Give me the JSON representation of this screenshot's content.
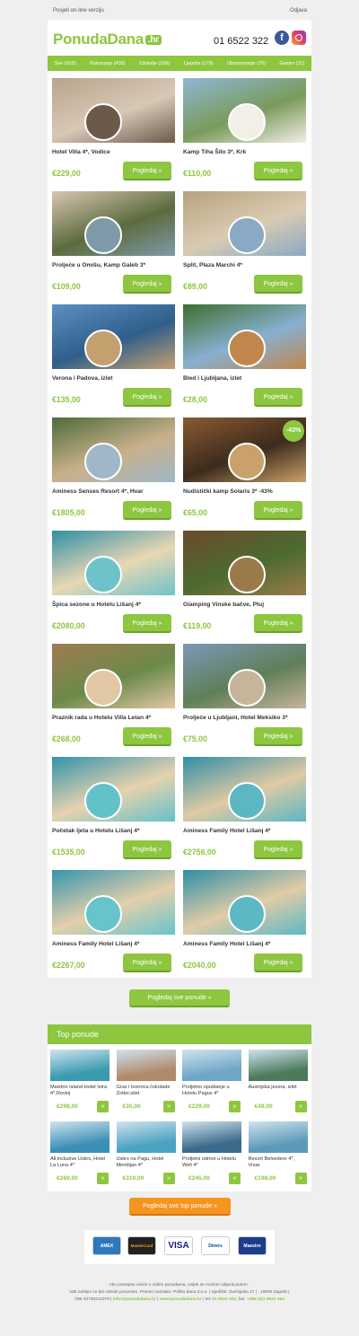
{
  "topbar": {
    "online_label": "Posjeti on-line verziju",
    "unsubscribe_label": "Odjava"
  },
  "header": {
    "logo_text": "PonudaDana",
    "logo_suffix": ".hr",
    "phone": "01 6522 322"
  },
  "nav": [
    {
      "label": "Sve (910)"
    },
    {
      "label": "Putovanja (439)"
    },
    {
      "label": "Zdravlje (166)"
    },
    {
      "label": "Ljepota (179)"
    },
    {
      "label": "Obrazovanje (70)"
    },
    {
      "label": "Gastro (11)"
    }
  ],
  "offers": [
    {
      "title": "Hotel Villa 4*, Vodice",
      "price": "€229,00",
      "button": "Pogledaj »"
    },
    {
      "title": "Kamp Tiha Šilo 3*, Krk",
      "price": "€110,00",
      "button": "Pogledaj »"
    },
    {
      "title": "Proljeće u Omišu, Kamp Galeb 3*",
      "price": "€109,00",
      "button": "Pogledaj »"
    },
    {
      "title": "Split, Plaza Marchi 4*",
      "price": "€89,00",
      "button": "Pogledaj »"
    },
    {
      "title": "Verona i Padova, izlet",
      "price": "€135,00",
      "button": "Pogledaj »"
    },
    {
      "title": "Bled i Ljubljana, izlet",
      "price": "€28,00",
      "button": "Pogledaj »"
    },
    {
      "title": "Aminess Senses Resort 4*, Hvar",
      "price": "€1805,00",
      "button": "Pogledaj »"
    },
    {
      "title": "Nudistički kamp Solaris 3* -43%",
      "price": "€65,00",
      "button": "Pogledaj »",
      "badge": "-43%"
    },
    {
      "title": "Špica sezone u Hotelu Lišanj 4*",
      "price": "€2080,00",
      "button": "Pogledaj »"
    },
    {
      "title": "Glamping Vinske bačve, Ptuj",
      "price": "€119,00",
      "button": "Pogledaj »"
    },
    {
      "title": "Praznik rada u Hotelu Villa Letan 4*",
      "price": "€268,00",
      "button": "Pogledaj »"
    },
    {
      "title": "Proljeće u Ljubljani, Hotel Meksiko 3*",
      "price": "€75,00",
      "button": "Pogledaj »"
    },
    {
      "title": "Početak ljeta u Hotelu Lišanj 4*",
      "price": "€1535,00",
      "button": "Pogledaj »"
    },
    {
      "title": "Aminess Family Hotel Lišanj 4*",
      "price": "€2756,00",
      "button": "Pogledaj »"
    },
    {
      "title": "Aminess Family Hotel Lišanj 4*",
      "price": "€2267,00",
      "button": "Pogledaj »"
    },
    {
      "title": "Aminess Family Hotel Lišanj 4*",
      "price": "€2040,00",
      "button": "Pogledaj »"
    }
  ],
  "see_all_label": "Pogledaj sve ponude »",
  "top_offers": {
    "heading": "Top ponude",
    "items": [
      {
        "title": "Maistrin Island Hotel Istra 4*,Rovinj",
        "price": "€298,00",
        "button": "»"
      },
      {
        "title": "Graz i tvornica čokolade Zotter,izlet",
        "price": "€30,00",
        "button": "»"
      },
      {
        "title": "Proljetno opuštanje u Hotelu Pagus 4*",
        "price": "€229,00",
        "button": "»"
      },
      {
        "title": "Austrijska jezera, izlet",
        "price": "€49,00",
        "button": "»"
      },
      {
        "title": "All inclusive Uskrs, Hotel La Luna 4*",
        "price": "€269,00",
        "button": "»"
      },
      {
        "title": "Uskrs na Pagu, Hotel Meridijan 4*",
        "price": "€319,00",
        "button": "»"
      },
      {
        "title": "Proljetni odmor u Hotelu Well 4*",
        "price": "€245,00",
        "button": "»"
      },
      {
        "title": "Resort Belvedere 4*, Vrsar",
        "price": "€198,00",
        "button": "»"
      }
    ],
    "see_all_label": "Pogledaj sve top ponude »"
  },
  "payments": [
    {
      "name": "AMEX"
    },
    {
      "name": "MasterCard"
    },
    {
      "name": "VISA"
    },
    {
      "name": "Diners"
    },
    {
      "name": "Maestro"
    }
  ],
  "footer": {
    "line1": "Ako postajete ovisni o našim ponudama, uvijek se možete odjaviti putem .",
    "line2": "Vaš zahtjev će biti odmah proveden. Pravne naznake: Prilika dana d.o.o. | Sjedište: Zvečajska 17 | , 10000 Zagreb |",
    "oib": "OIB 43728211079 |",
    "email": "info@ponudadana.hr",
    "site": "www.ponudadana.hr",
    "tel_label": "| tel:",
    "tel": "01 6522 322",
    "fax_label": ", fax:",
    "fax": "+385 (0)1 6522 264"
  }
}
